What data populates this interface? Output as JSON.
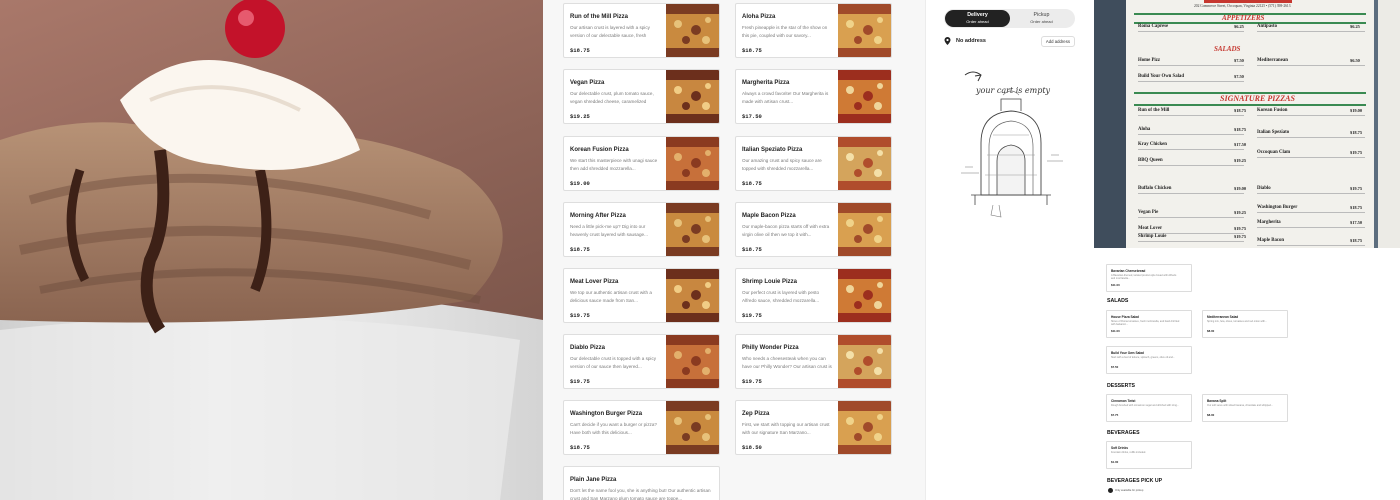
{
  "menu_items": [
    {
      "name": "Run of the Mill Pizza",
      "desc": "Our artisan crust is layered with a spicy version of our delectable sauce, fresh mozzarella...",
      "price": "$18.75"
    },
    {
      "name": "Aloha Pizza",
      "desc": "Fresh pineapple is the star of the show on this pie, coupled with our savory...",
      "price": "$18.75"
    },
    {
      "name": "Vegan Pizza",
      "desc": "Our delectable crust, plum tomato sauce, vegan shredded cheese, caramelized onions, fresh mushrooms, roasted red...",
      "price": "$19.25"
    },
    {
      "name": "Margherita Pizza",
      "desc": "Always a crowd favorite! Our Margherita is made with artisan crust...",
      "price": "$17.50"
    },
    {
      "name": "Korean Fusion Pizza",
      "desc": "We start this masterpiece with unagi sauce then add shredded mozzarella...",
      "price": "$19.00"
    },
    {
      "name": "Italian Spezіato Pizza",
      "desc": "Our amazing crust and spicy sauce are topped with shredded mozzarella...",
      "price": "$18.75"
    },
    {
      "name": "Morning After Pizza",
      "desc": "Need a little pick-me up? Dig into our heavenly crust layered with sausage...",
      "price": "$18.75"
    },
    {
      "name": "Maple Bacon Pizza",
      "desc": "Our maple-bacon pizza starts off with extra virgin olive oil then we top it with...",
      "price": "$18.75"
    },
    {
      "name": "Meat Lover Pizza",
      "desc": "We top our authentic artisan crust with a delicious sauce made from San...",
      "price": "$19.75"
    },
    {
      "name": "Shrimp Louie Pizza",
      "desc": "Our perfect crust is layered with pesto Alfredo sauce, shredded mozzarella...",
      "price": "$19.75"
    },
    {
      "name": "Diablo Pizza",
      "desc": "Our delectable crust is topped with a spicy version of our sauce then layered...",
      "price": "$19.75"
    },
    {
      "name": "Philly Wonder Pizza",
      "desc": "Who needs a cheesesteak when you can have our Philly Wonder? Our artisan crust is topped with Alfredo sauce...",
      "price": "$19.75"
    },
    {
      "name": "Washington Burger Pizza",
      "desc": "Can't decide if you want a burger or pizza? Have both with this delicious...",
      "price": "$18.75"
    },
    {
      "name": "Zep Pizza",
      "desc": "First, we start with topping our artisan crust with our signature San Marzano...",
      "price": "$18.50"
    },
    {
      "name": "Plain Jane Pizza",
      "desc": "Don't let the name fool you, she is anything but! Our authentic artisan crust and San Marzano plum tomato sauce are toppe...",
      "price": ""
    }
  ],
  "cart": {
    "delivery_label": "Delivery",
    "delivery_sub": "Order ahead",
    "pickup_label": "Pickup",
    "pickup_sub": "Order ahead",
    "address_text": "No address",
    "add_address_label": "Add address",
    "empty_text": "your cart is empty",
    "active_mode": "delivery"
  },
  "menu_photo": {
    "address": "202 Commerce Street, Occoquan, Virginia 22125 • (571) 398-2613",
    "sections": [
      "APPETIZERS",
      "SALADS",
      "SIGNATURE PIZZAS"
    ],
    "left_items": [
      {
        "name": "Roma Caprese",
        "price": "$6.25"
      },
      {
        "name": "Home Pizz",
        "price": "$7.50"
      },
      {
        "name": "Build Your Own Salad",
        "price": "$7.50"
      },
      {
        "name": "Run of the Mill",
        "price": "$18.75"
      },
      {
        "name": "Aloha",
        "price": "$18.75"
      },
      {
        "name": "Kray Chicken",
        "price": "$17.50"
      },
      {
        "name": "BBQ Queen",
        "price": "$19.25"
      },
      {
        "name": "Buffalo Chicken",
        "price": "$19.00"
      },
      {
        "name": "Vegan Pie",
        "price": "$19.25"
      },
      {
        "name": "Meat Lover",
        "price": "$19.75"
      },
      {
        "name": "Shrimp Louie",
        "price": "$19.75"
      }
    ],
    "right_items": [
      {
        "name": "Antipasto",
        "price": "$6.25"
      },
      {
        "name": "Mediterranean",
        "price": "$6.50"
      },
      {
        "name": "Korean Fusion",
        "price": "$19.00"
      },
      {
        "name": "Italian Spezіato",
        "price": "$18.75"
      },
      {
        "name": "Occoquan Clam",
        "price": "$19.75"
      },
      {
        "name": "Diablo",
        "price": "$19.75"
      },
      {
        "name": "Washington Burger",
        "price": "$18.75"
      },
      {
        "name": "Margherita",
        "price": "$17.50"
      },
      {
        "name": "Maple Bacon",
        "price": "$18.75"
      }
    ]
  },
  "mini_menu": {
    "top_card": {
      "name": "Bavarian Cheesebread",
      "desc": "A Bavarian-themed, twisted pretzel-style bread with Alfredo and mozzarella...",
      "price": "$11.00"
    },
    "salads_heading": "SALADS",
    "salads": [
      {
        "name": "House Pizza Salad",
        "desc": "Slices of Roma tomatoes, fresh mozzarella, and basil drizzled with balsamic...",
        "price": "$11.00"
      },
      {
        "name": "Mediterranean Salad",
        "desc": "Spring mix, feta, olives, tomatoes and red onion with...",
        "price": "$8.00"
      },
      {
        "name": "Build Your Own Salad",
        "desc": "Start with a bed of lettuce, spinach, greens, olive oil and...",
        "price": "$7.50"
      }
    ],
    "desserts_heading": "DESSERTS",
    "desserts": [
      {
        "name": "Cinnamon Twist",
        "desc": "Dough brushed with cinnamon sugar and drizzled with icing...",
        "price": "$7.75"
      },
      {
        "name": "Banana Split",
        "desc": "Our soft serve with sliced banana, chocolate and whipped...",
        "price": "$8.00"
      }
    ],
    "beverages_heading": "BEVERAGES",
    "beverages": [
      {
        "name": "Soft Drinks",
        "desc": "Fountain drinks, refills included.",
        "price": "$1.00"
      }
    ],
    "pickup_heading": "BEVERAGES PICK UP",
    "pickup_note": "Only available for pickup"
  },
  "icons": {
    "address_pin": "map-pin-icon",
    "empty_cart_art": "pizza-oven-illustration"
  },
  "colors": {
    "toggle_active_bg": "#222222",
    "menu_header_red": "#c6372f",
    "menu_green": "#3a8a52"
  }
}
